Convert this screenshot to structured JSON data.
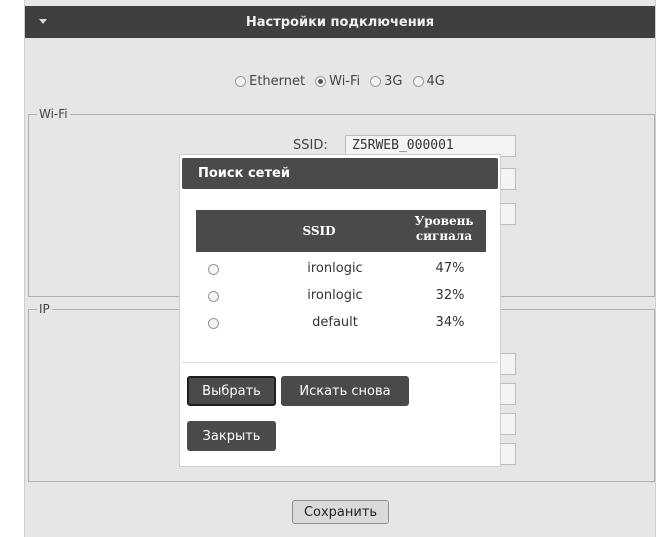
{
  "header": {
    "title": "Настройки подключения"
  },
  "connection": {
    "options": [
      {
        "label": "Ethernet",
        "selected": false
      },
      {
        "label": "Wi-Fi",
        "selected": true
      },
      {
        "label": "3G",
        "selected": false
      },
      {
        "label": "4G",
        "selected": false
      }
    ]
  },
  "wifi": {
    "legend": "Wi-Fi",
    "ssid_label": "SSID:",
    "ssid_value": "Z5RWEB_000001"
  },
  "ip": {
    "legend": "IP"
  },
  "footer": {
    "save_label": "Сохранить"
  },
  "modal": {
    "title": "Поиск сетей",
    "columns": {
      "ssid": "SSID",
      "level_line1": "Уровень",
      "level_line2": "сигнала"
    },
    "rows": [
      {
        "ssid": "ironlogic",
        "level": "47%"
      },
      {
        "ssid": "ironlogic",
        "level": "32%"
      },
      {
        "ssid": "default",
        "level": "34%"
      }
    ],
    "select_label": "Выбрать",
    "rescan_label": "Искать снова",
    "close_label": "Закрыть"
  }
}
